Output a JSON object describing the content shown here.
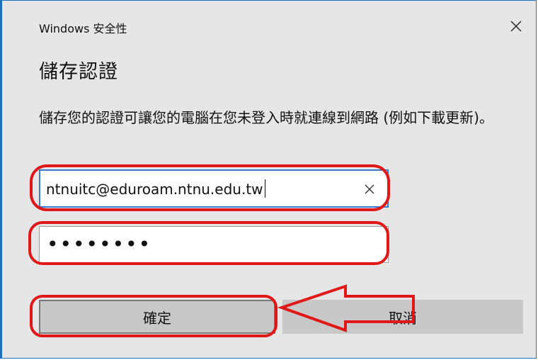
{
  "dialog": {
    "window_title": "Windows 安全性",
    "heading": "儲存認證",
    "description": "儲存您的認證可讓您的電腦在您未登入時就連線到網路 (例如下載更新)。"
  },
  "fields": {
    "username_value": "ntnuitc@eduroam.ntnu.edu.tw",
    "password_value": "••••••••"
  },
  "buttons": {
    "ok_label": "確定",
    "cancel_label": "取消"
  },
  "icons": {
    "close": "close-icon",
    "clear": "clear-icon"
  },
  "colors": {
    "dialog_background": "#e6e6e6",
    "accent_border": "#1f6fc0",
    "annotation_red": "#e01818"
  }
}
